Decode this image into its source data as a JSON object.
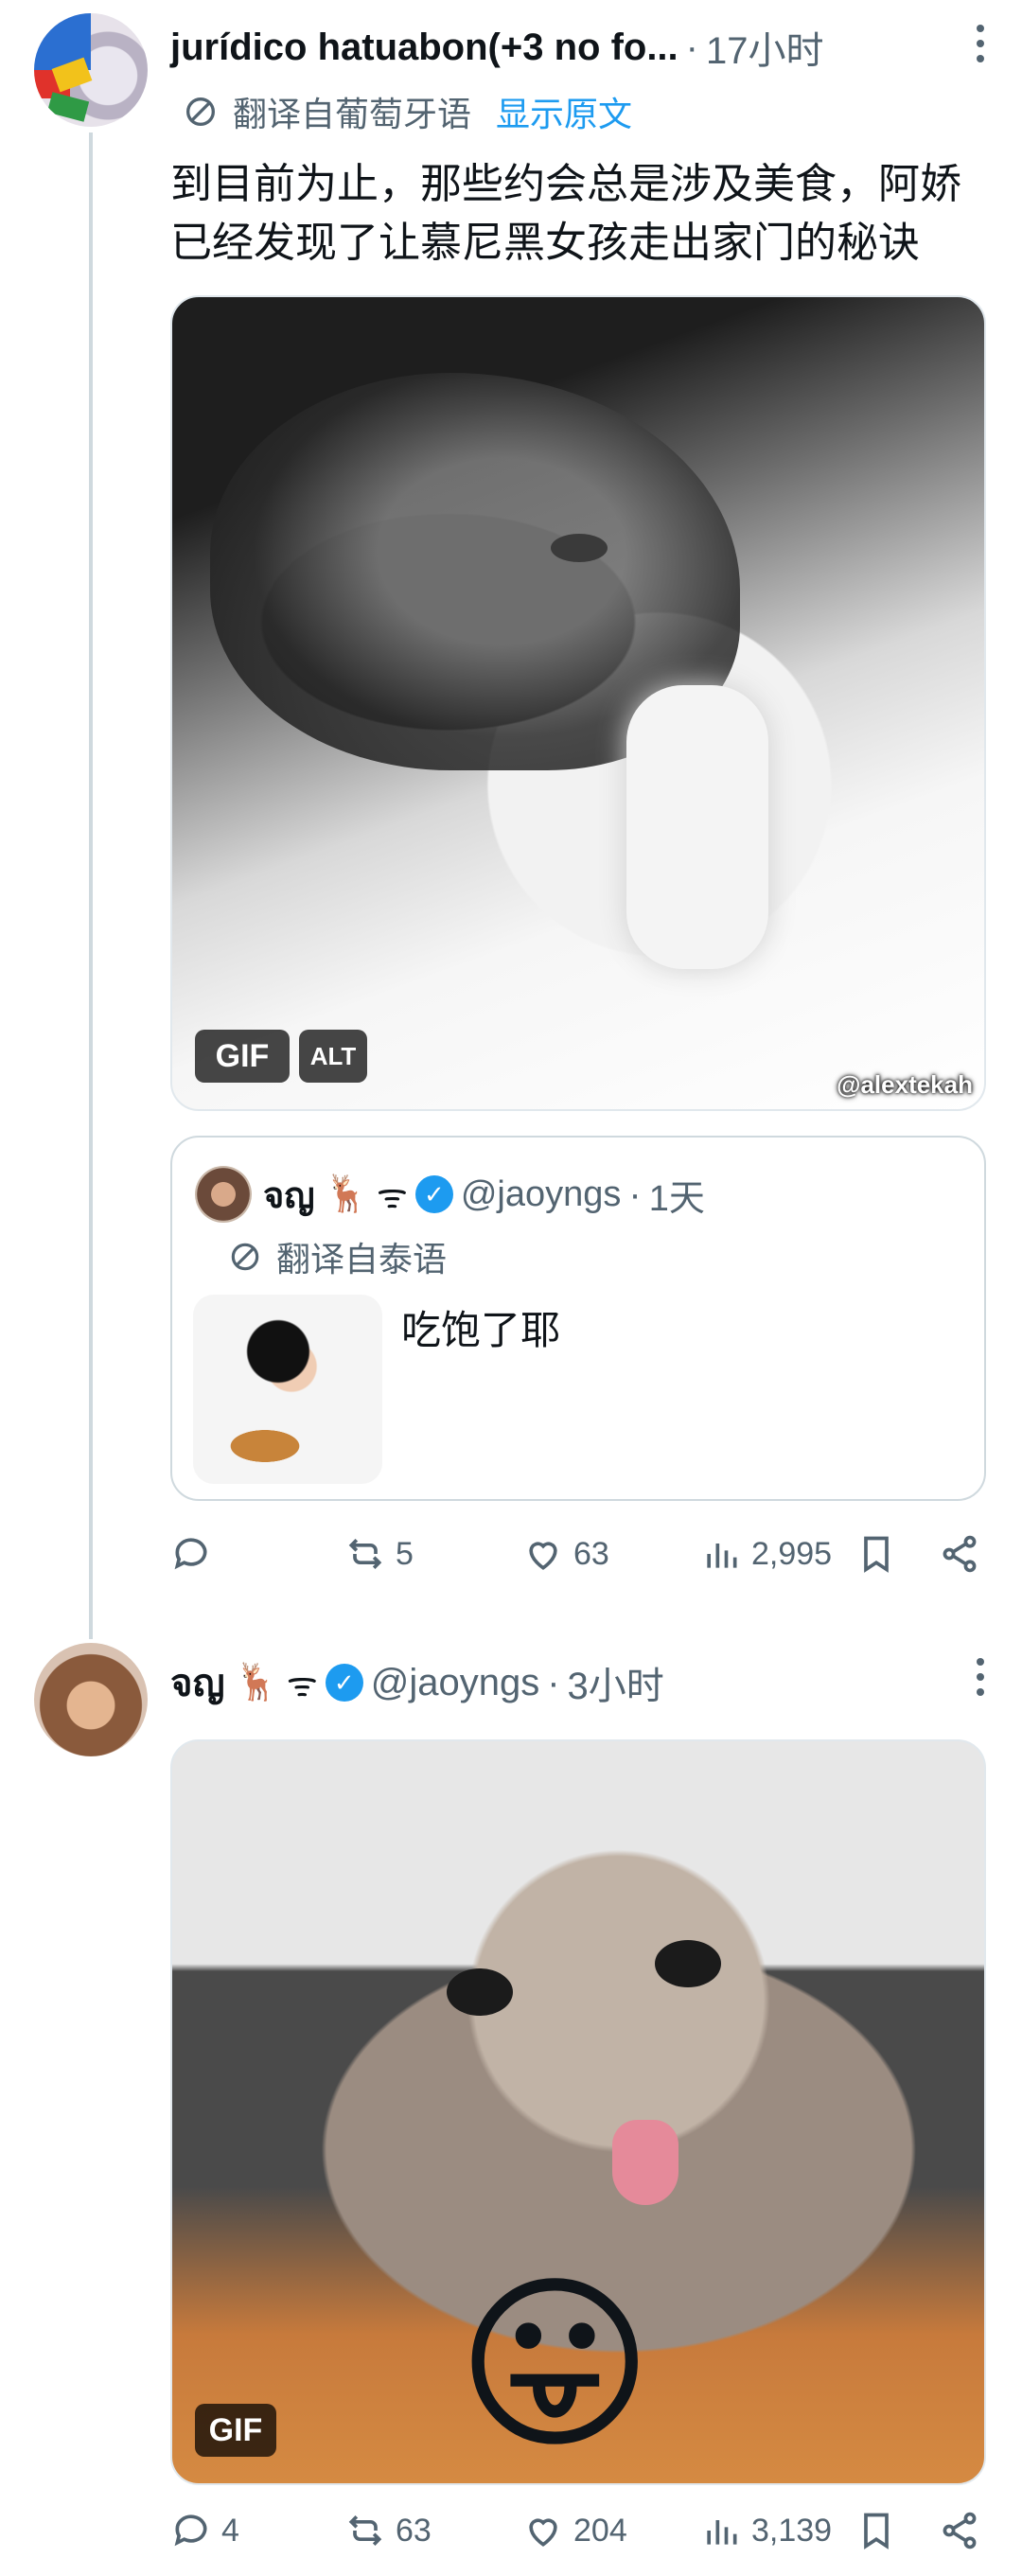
{
  "tweet1": {
    "author_name": "jurídico hatuabon(+3 no fo...",
    "time": "17小时",
    "translated_from": "翻译自葡萄牙语",
    "show_original": "显示原文",
    "text": "到目前为止，那些约会总是涉及美食，阿娇已经发现了让慕尼黑女孩走出家门的秘诀",
    "media": {
      "gif_badge": "GIF",
      "alt_badge": "ALT",
      "watermark": "@alextekah"
    },
    "quote": {
      "name": "จญ",
      "emojis": "🦌",
      "thai_mark": "ᯤ",
      "handle": "@jaoyngs",
      "time": "1天",
      "translated_from": "翻译自泰语",
      "text": "吃饱了耶"
    },
    "actions": {
      "reply": "",
      "retweets": "5",
      "likes": "63",
      "views": "2,995"
    }
  },
  "tweet2": {
    "name": "จญ",
    "emojis": "🦌",
    "thai_mark": "ᯤ",
    "handle": "@jaoyngs",
    "time": "3小时",
    "media": {
      "gif_badge": "GIF",
      "emoji": "😛"
    },
    "actions": {
      "reply": "4",
      "retweets": "63",
      "likes": "204",
      "views": "3,139"
    }
  },
  "colors": {
    "link": "#1d9bf0",
    "secondary": "#536471",
    "text": "#0f1419",
    "verified": "#1d9bf0"
  }
}
